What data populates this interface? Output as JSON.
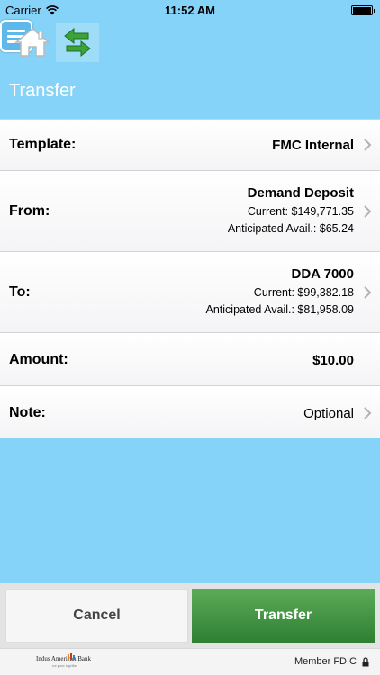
{
  "status_bar": {
    "carrier": "Carrier",
    "time": "11:52 AM"
  },
  "toolbar": {
    "home_icon": "home-icon",
    "transfer_icon": "transfer-arrows-icon",
    "menu_icon": "hamburger-menu-icon"
  },
  "page": {
    "title": "Transfer"
  },
  "form": {
    "template": {
      "label": "Template:",
      "value": "FMC Internal"
    },
    "from": {
      "label": "From:",
      "account": "Demand Deposit",
      "current": "Current: $149,771.35",
      "anticipated": "Anticipated Avail.: $65.24"
    },
    "to": {
      "label": "To:",
      "account": "DDA 7000",
      "current": "Current: $99,382.18",
      "anticipated": "Anticipated Avail.: $81,958.09"
    },
    "amount": {
      "label": "Amount:",
      "value": "$10.00"
    },
    "note": {
      "label": "Note:",
      "placeholder": "Optional"
    }
  },
  "buttons": {
    "cancel": "Cancel",
    "transfer": "Transfer"
  },
  "footer": {
    "bank_logo_text": "Indus American Bank",
    "bank_tagline": "we grow together",
    "member_fdic": "Member FDIC"
  },
  "colors": {
    "header_blue": "#86d3f9",
    "transfer_green": "#3d8f3f",
    "menu_blue": "#5fb8ec"
  }
}
